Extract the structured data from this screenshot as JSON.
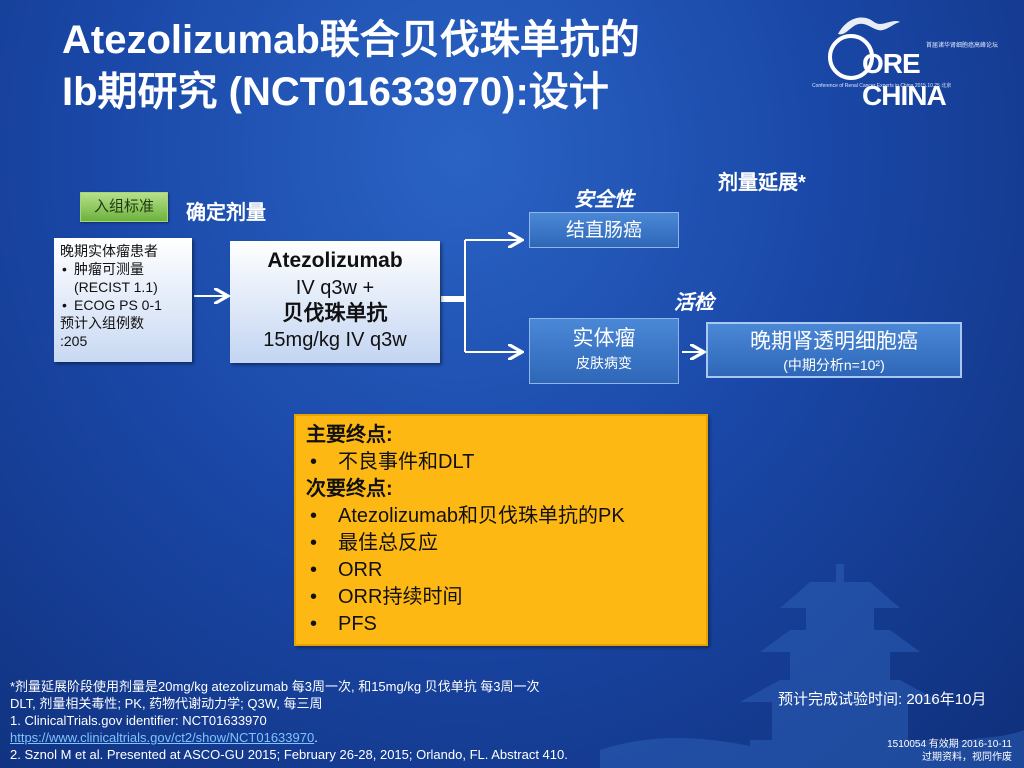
{
  "title_line1": "Atezolizumab联合贝伐珠单抗的",
  "title_line2": "Ib期研究 (NCT01633970):设计",
  "logo": {
    "text": "ORE CHINA",
    "small": "首届诸华肾细胞癌高峰论坛",
    "sub": "Conference of Renal Cancer Experts in China  2015.10.25 北京"
  },
  "enroll_tag": "入组标准",
  "dose_label": "确定剂量",
  "patients": {
    "line1": "晚期实体瘤患者",
    "bullet1": "肿瘤可测量",
    "bullet1_sub": "(RECIST 1.1)",
    "bullet2": "ECOG PS 0-1",
    "line2": "预计入组例数",
    "line3": ":205"
  },
  "drug": {
    "l1": "Atezolizumab",
    "l2": "IV q3w +",
    "l3": "贝伐珠单抗",
    "l4": "15mg/kg IV q3w"
  },
  "safety_label": "安全性",
  "crc_box": "结直肠癌",
  "expansion_label": "剂量延展*",
  "biopsy_label": "活检",
  "solid_box": {
    "a": "实体瘤",
    "b": "皮肤病变"
  },
  "rcc_box": {
    "a": "晚期肾透明细胞癌",
    "b": "(中期分析n=10²)"
  },
  "endpoints": {
    "primary_header": "主要终点:",
    "primary_items": [
      "不良事件和DLT"
    ],
    "secondary_header": "次要终点:",
    "secondary_items": [
      "Atezolizumab和贝伐珠单抗的PK",
      "最佳总反应",
      "ORR",
      "ORR持续时间",
      "PFS"
    ]
  },
  "footnotes": {
    "f1": "*剂量延展阶段使用剂量是20mg/kg  atezolizumab  每3周一次, 和15mg/kg 贝伐单抗 每3周一次",
    "f2": "DLT, 剂量相关毒性; PK, 药物代谢动力学; Q3W, 每三周",
    "f3": "1. ClinicalTrials.gov identifier: NCT01633970",
    "f4": "https://www.clinicaltrials.gov/ct2/show/NCT01633970",
    "f4_after": ".",
    "f5": "2. Sznol M et al. Presented at ASCO-GU  2015; February 26-28, 2015; Orlando, FL. Abstract 410."
  },
  "completion": "预计完成试验时间: 2016年10月",
  "code_line1": "1510054  有效期  2016-10-11",
  "code_line2": "过期资料，视同作废"
}
